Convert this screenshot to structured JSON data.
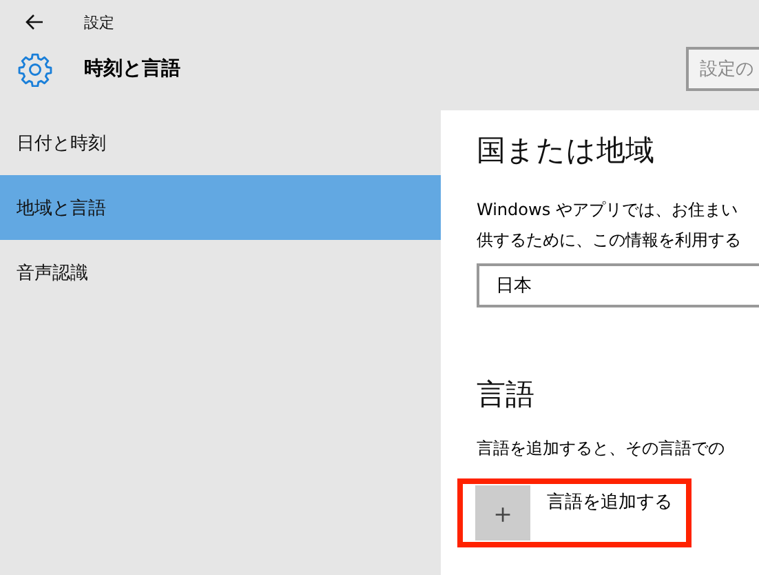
{
  "window": {
    "title": "設定"
  },
  "header": {
    "title": "時刻と言語",
    "search": {
      "placeholder": "設定の"
    }
  },
  "sidebar": {
    "items": [
      {
        "label": "日付と時刻",
        "selected": false
      },
      {
        "label": "地域と言語",
        "selected": true
      },
      {
        "label": "音声認識",
        "selected": false
      }
    ]
  },
  "region": {
    "heading": "国または地域",
    "description_lines": [
      "Windows やアプリでは、お住まい",
      "供するために、この情報を利用する"
    ],
    "dropdown": {
      "value": "日本"
    }
  },
  "language": {
    "heading": "言語",
    "description": "言語を追加すると、その言語での",
    "add_button": {
      "icon": "＋",
      "label": "言語を追加する",
      "highlighted": true
    }
  }
}
